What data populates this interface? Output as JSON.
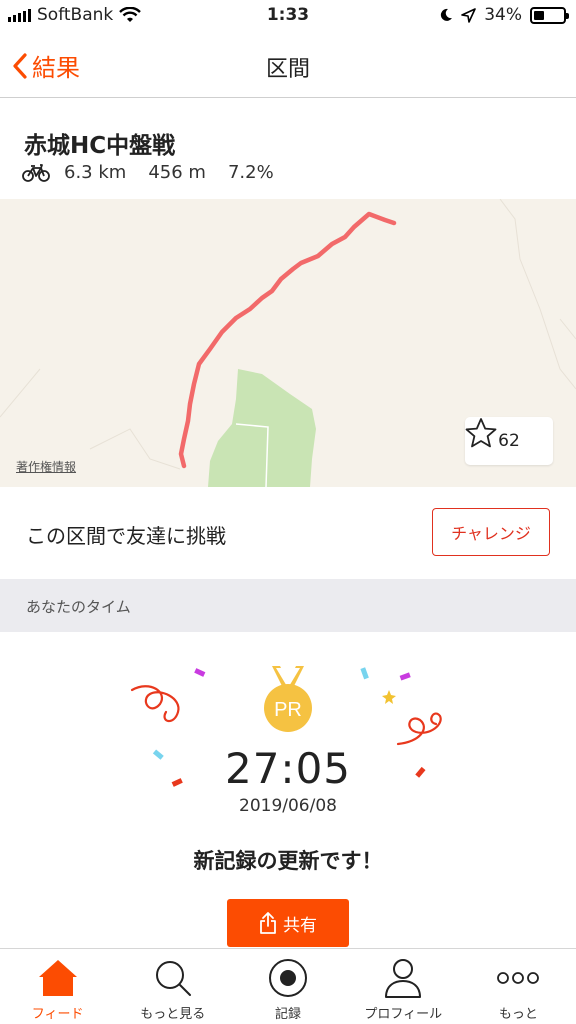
{
  "status_bar": {
    "carrier": "SoftBank",
    "time": "1:33",
    "battery": "34%",
    "battery_level": 0.34
  },
  "nav": {
    "back_label": "結果",
    "title": "区間"
  },
  "segment": {
    "name": "赤城HC中盤戦",
    "distance": "6.3 km",
    "elevation": "456 m",
    "grade": "7.2%",
    "activity_icon": "bicycle-icon"
  },
  "map": {
    "attribution": "著作権情報",
    "star_count": "62"
  },
  "challenge": {
    "text": "この区間で友達に挑戦",
    "button_label": "チャレンジ"
  },
  "your_time": {
    "section_label": "あなたのタイム",
    "badge": "PR",
    "time": "27:05",
    "date": "2019/06/08",
    "message": "新記録の更新です！",
    "share_label": "共有"
  },
  "tabs": [
    {
      "label": "フィード",
      "icon": "home-icon",
      "active": true
    },
    {
      "label": "もっと見る",
      "icon": "search-icon",
      "active": false
    },
    {
      "label": "記録",
      "icon": "record-icon",
      "active": false
    },
    {
      "label": "プロフィール",
      "icon": "profile-icon",
      "active": false
    },
    {
      "label": "もっと",
      "icon": "more-icon",
      "active": false
    }
  ],
  "colors": {
    "accent": "#fc4c02",
    "route": "#f26a6a",
    "challenge": "#e0311f",
    "medal": "#f5c242"
  }
}
